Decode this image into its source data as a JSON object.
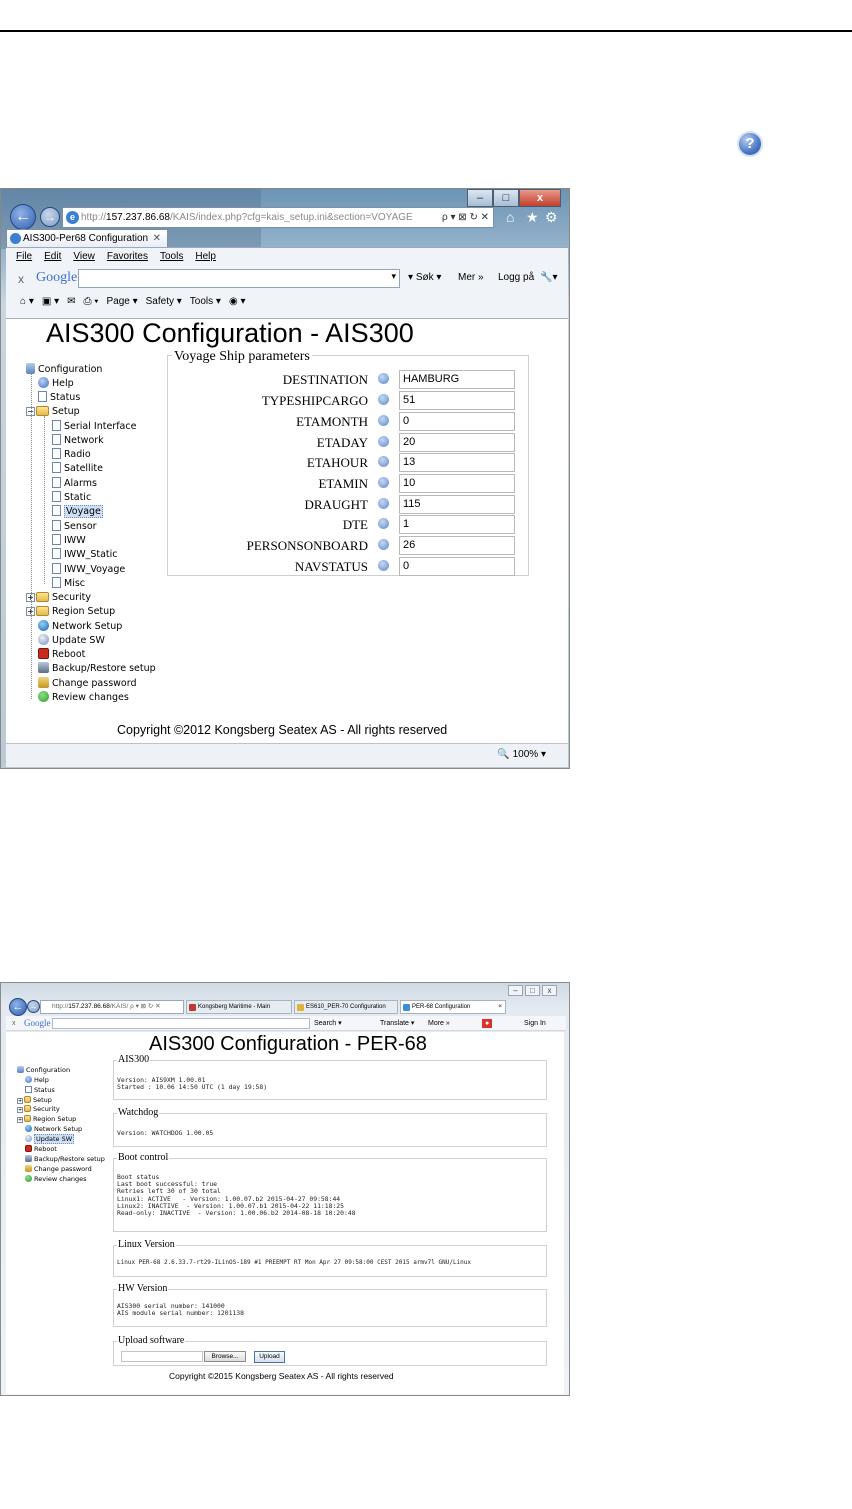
{
  "help_icon": "question-icon",
  "shot1": {
    "window_controls": [
      "–",
      "□",
      "x"
    ],
    "address": {
      "prefix": "http://",
      "host": "157.237.86.68",
      "path": "/KAIS/index.php?cfg=kais_setup.ini&section=VOYAGE",
      "controls": "ρ ▾ ⊠ ↻ ✕"
    },
    "tab_title": "AIS300-Per68 Configuration",
    "tab_close": "✕",
    "menu": [
      "File",
      "Edit",
      "View",
      "Favorites",
      "Tools",
      "Help"
    ],
    "google": {
      "logo": "Google",
      "search_label": "Søk",
      "more": "Mer »",
      "login": "Logg på"
    },
    "command_bar": [
      "Page ▾",
      "Safety ▾",
      "Tools ▾"
    ],
    "heading": "AIS300 Configuration - AIS300",
    "tree": {
      "root": "Configuration",
      "items": [
        {
          "label": "Help",
          "icon": "help-icon"
        },
        {
          "label": "Status",
          "icon": "page-icon"
        },
        {
          "label": "Setup",
          "icon": "folder-icon"
        },
        {
          "label": "Serial Interface",
          "icon": "page-icon"
        },
        {
          "label": "Network",
          "icon": "page-icon"
        },
        {
          "label": "Radio",
          "icon": "page-icon"
        },
        {
          "label": "Satellite",
          "icon": "page-icon"
        },
        {
          "label": "Alarms",
          "icon": "page-icon"
        },
        {
          "label": "Static",
          "icon": "page-icon"
        },
        {
          "label": "Voyage",
          "icon": "page-icon"
        },
        {
          "label": "Sensor",
          "icon": "page-icon"
        },
        {
          "label": "IWW",
          "icon": "page-icon"
        },
        {
          "label": "IWW_Static",
          "icon": "page-icon"
        },
        {
          "label": "IWW_Voyage",
          "icon": "page-icon"
        },
        {
          "label": "Misc",
          "icon": "page-icon"
        },
        {
          "label": "Security",
          "icon": "folder-icon"
        },
        {
          "label": "Region Setup",
          "icon": "folder-icon"
        },
        {
          "label": "Network Setup",
          "icon": "globe-icon"
        },
        {
          "label": "Update SW",
          "icon": "update-icon"
        },
        {
          "label": "Reboot",
          "icon": "reboot-icon"
        },
        {
          "label": "Backup/Restore setup",
          "icon": "backup-icon"
        },
        {
          "label": "Change password",
          "icon": "lock-icon"
        },
        {
          "label": "Review changes",
          "icon": "check-icon"
        }
      ]
    },
    "fieldset_title": "Voyage Ship parameters",
    "fields": [
      {
        "label": "DESTINATION",
        "value": "HAMBURG"
      },
      {
        "label": "TYPESHIPCARGO",
        "value": "51"
      },
      {
        "label": "ETAMONTH",
        "value": "0"
      },
      {
        "label": "ETADAY",
        "value": "20"
      },
      {
        "label": "ETAHOUR",
        "value": "13"
      },
      {
        "label": "ETAMIN",
        "value": "10"
      },
      {
        "label": "DRAUGHT",
        "value": "115"
      },
      {
        "label": "DTE",
        "value": "1"
      },
      {
        "label": "PERSONSONBOARD",
        "value": "26"
      },
      {
        "label": "NAVSTATUS",
        "value": "0"
      }
    ],
    "copyright": "Copyright ©2012 Kongsberg Seatex AS - All rights reserved",
    "zoom": "100%"
  },
  "shot2": {
    "address": {
      "prefix": "http://",
      "host": "157.237.86.68",
      "path": "/KAIS/ ρ ▾ ⊠ ↻ ✕"
    },
    "tabs": [
      "Kongsberg Maritime - Main",
      "ES610_PER-70 Configuration",
      "PER-68 Configuration"
    ],
    "google": {
      "logo": "Google",
      "search": "Search ▾",
      "translate": "Translate ▾",
      "more": "More »",
      "sign_in": "Sign In"
    },
    "heading": "AIS300 Configuration - PER-68",
    "tree": {
      "root": "Configuration",
      "items": [
        "Help",
        "Status",
        "Setup",
        "Security",
        "Region Setup",
        "Network Setup",
        "Update SW",
        "Reboot",
        "Backup/Restore setup",
        "Change password",
        "Review changes"
      ]
    },
    "sections": [
      {
        "title": "AIS300",
        "text": "Version: AIS9XM 1.00.01\nStarted : 10.06 14:50 UTC (1 day 19:58)"
      },
      {
        "title": "Watchdog",
        "text": "Version: WATCHDOG 1.00.05"
      },
      {
        "title": "Boot control",
        "text": "Boot status\nLast boot successful: true\nRetries left 30 of 30 total\nLinux1: ACTIVE   - Version: 1.00.07.b2 2015-04-27 09:58:44\nLinux2: INACTIVE  - Version: 1.00.07.b1 2015-04-22 11:18:25\nRead-only: INACTIVE  - Version: 1.00.06.b2 2014-08-18 10:20:48"
      },
      {
        "title": "Linux Version",
        "text": "Linux PER-68 2.6.33.7-rt29-ILinOS-189 #1 PREEMPT RT Mon Apr 27 09:58:00 CEST 2015 armv7l GNU/Linux"
      },
      {
        "title": "HW Version",
        "text": "AIS300 serial number: 141000\nAIS module serial number: 1201138"
      },
      {
        "title": "Upload software",
        "text": ""
      }
    ],
    "browse_label": "Browse...",
    "upload_label": "Upload",
    "copyright": "Copyright ©2015 Kongsberg Seatex AS - All rights reserved"
  }
}
